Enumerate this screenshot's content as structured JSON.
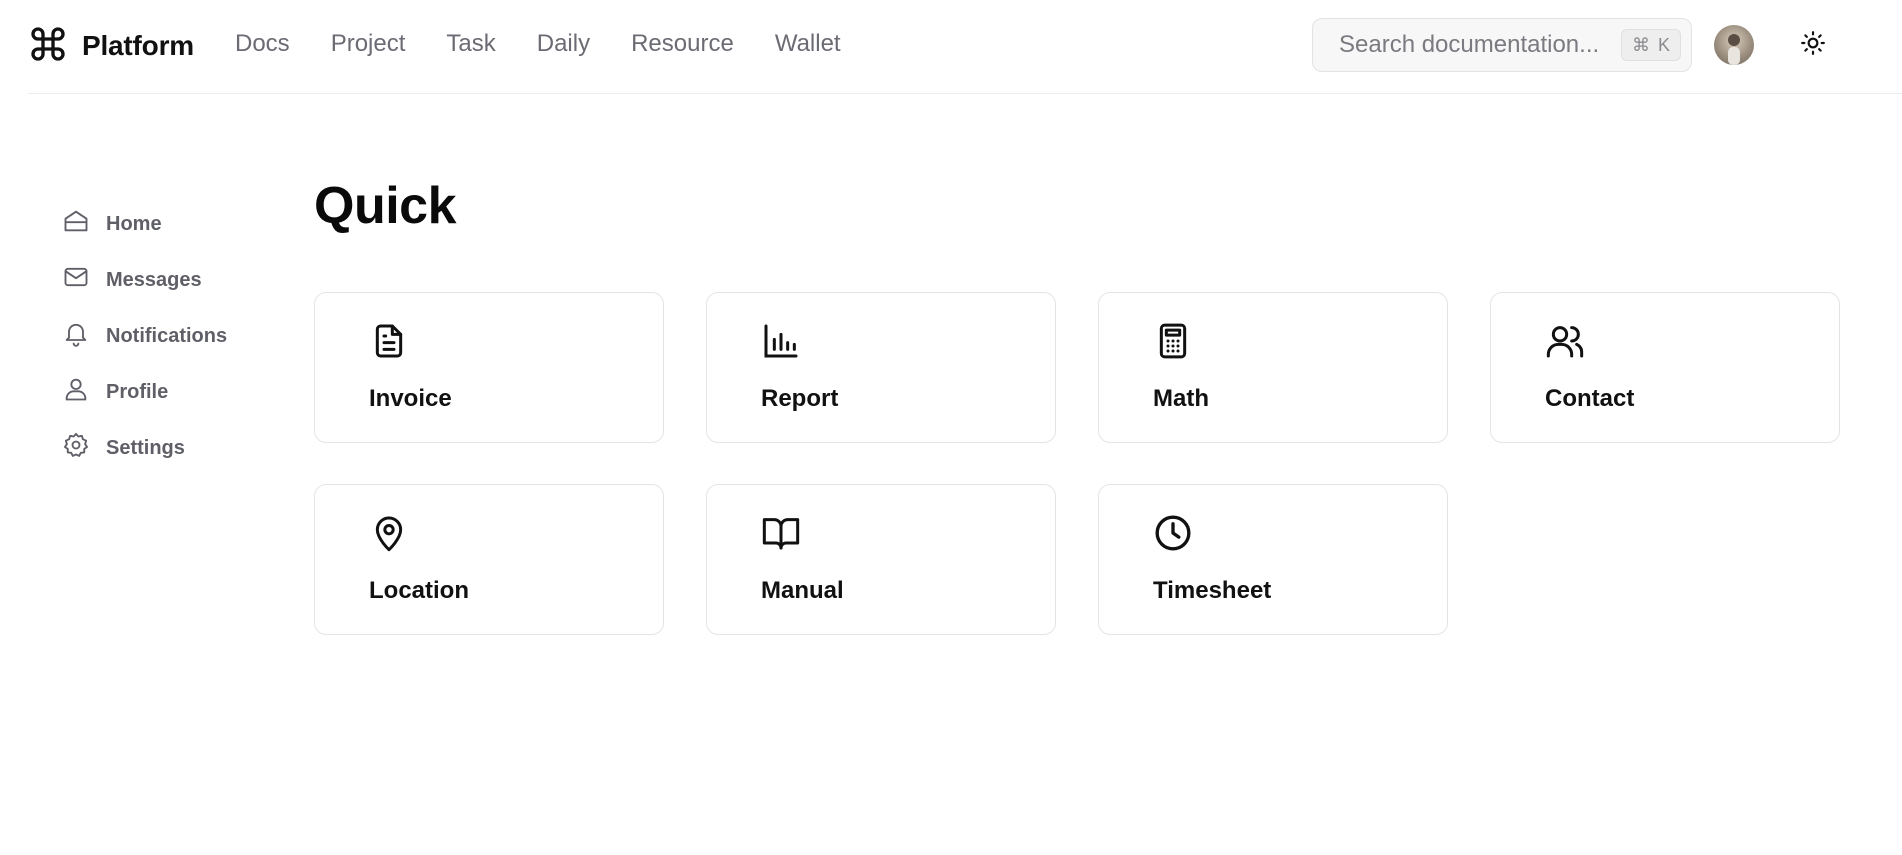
{
  "brand": {
    "name": "Platform",
    "icon": "command-icon"
  },
  "nav": {
    "items": [
      "Docs",
      "Project",
      "Task",
      "Daily",
      "Resource",
      "Wallet"
    ]
  },
  "search": {
    "placeholder": "Search documentation...",
    "shortcut_symbol": "⌘",
    "shortcut_key": "K"
  },
  "header": {
    "avatar_icon": "user-avatar",
    "theme_icon": "sun-icon"
  },
  "sidebar": {
    "items": [
      {
        "label": "Home",
        "icon": "home-icon"
      },
      {
        "label": "Messages",
        "icon": "mail-icon"
      },
      {
        "label": "Notifications",
        "icon": "bell-icon"
      },
      {
        "label": "Profile",
        "icon": "user-icon"
      },
      {
        "label": "Settings",
        "icon": "gear-icon"
      }
    ]
  },
  "main": {
    "title": "Quick",
    "cards": [
      {
        "label": "Invoice",
        "icon": "file-text-icon"
      },
      {
        "label": "Report",
        "icon": "bar-chart-icon"
      },
      {
        "label": "Math",
        "icon": "calculator-icon"
      },
      {
        "label": "Contact",
        "icon": "users-icon"
      },
      {
        "label": "Location",
        "icon": "map-pin-icon"
      },
      {
        "label": "Manual",
        "icon": "book-open-icon"
      },
      {
        "label": "Timesheet",
        "icon": "clock-icon"
      }
    ]
  },
  "colors": {
    "text": "#111111",
    "muted": "#6b6b73",
    "border": "#e4e4e4",
    "search_bg": "#f7f7f7"
  }
}
